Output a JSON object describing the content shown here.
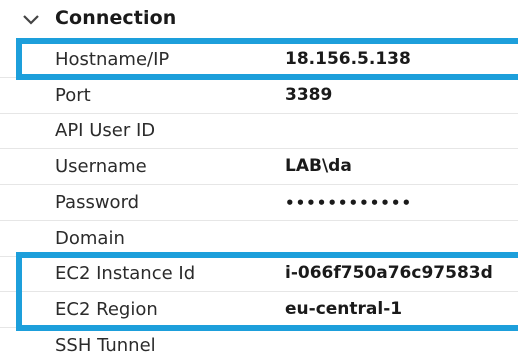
{
  "section": {
    "title": "Connection",
    "expanded": true
  },
  "rows": [
    {
      "label": "Hostname/IP",
      "value": "18.156.5.138"
    },
    {
      "label": "Port",
      "value": "3389"
    },
    {
      "label": "API User ID",
      "value": ""
    },
    {
      "label": "Username",
      "value": "LAB\\da"
    },
    {
      "label": "Password",
      "value": "••••••••••••"
    },
    {
      "label": "Domain",
      "value": ""
    },
    {
      "label": "EC2 Instance Id",
      "value": "i-066f750a76c97583d"
    },
    {
      "label": "EC2 Region",
      "value": "eu-central-1"
    },
    {
      "label": "SSH Tunnel",
      "value": ""
    }
  ],
  "colors": {
    "highlight": "#1d9fdb",
    "text": "#1a1a1a"
  },
  "icons": {
    "section_toggle": "chevron-down-icon"
  }
}
